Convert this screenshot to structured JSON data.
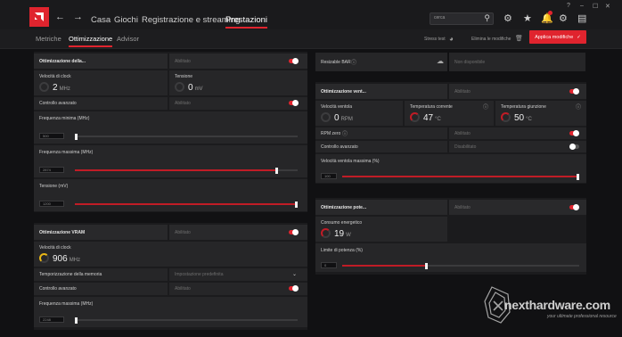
{
  "topbar": {
    "logo": "AMD",
    "tabs": [
      {
        "label": "Casa"
      },
      {
        "label": "Giochi"
      },
      {
        "label": "Registrazione e streaming"
      },
      {
        "label": "Prestazioni"
      }
    ],
    "search_placeholder": "cerca",
    "icons": [
      "back-icon",
      "forward-icon",
      "search-icon",
      "bug-icon",
      "star-icon",
      "bell-icon",
      "gear-icon",
      "sidebar-icon"
    ],
    "window_controls": [
      "?",
      "–",
      "☐",
      "✕"
    ]
  },
  "subbar": {
    "tabs": [
      {
        "label": "Metriche"
      },
      {
        "label": "Ottimizzazione"
      },
      {
        "label": "Advisor"
      }
    ],
    "stress_test": "Stress test",
    "discard": "Elimina le modifiche",
    "apply": "Applica modifiche"
  },
  "gpu_tuning": {
    "title": "Ottimizzazione della...",
    "status": "Abilitato",
    "clock_label": "Velocità di clock",
    "clock_value": "2",
    "clock_unit": "MHz",
    "voltage_label": "Tensione",
    "voltage_value": "0",
    "voltage_unit": "mV",
    "advanced_label": "Controllo avanzato",
    "advanced_status": "Abilitato",
    "min_freq_label": "Frequenza minima (MHz)",
    "min_freq_value": "500",
    "min_freq_fraction": 0.0,
    "max_freq_label": "Frequenza massima (MHz)",
    "max_freq_value": "2874",
    "max_freq_fraction": 0.91,
    "voltage_slider_label": "Tensione (mV)",
    "voltage_slider_value": "1200",
    "voltage_slider_fraction": 1.0
  },
  "vram_tuning": {
    "title": "Ottimizzazione VRAM",
    "status": "Abilitato",
    "clock_label": "Velocità di clock",
    "clock_value": "906",
    "clock_unit": "MHz",
    "timing_label": "Temporizzazione della memoria",
    "timing_value": "Impostazione predefinita",
    "advanced_label": "Controllo avanzato",
    "advanced_status": "Abilitato",
    "max_freq_label": "Frequenza massima (MHz)",
    "max_freq_value": "2248",
    "max_freq_fraction": 0.0
  },
  "resizable_bar": {
    "label": "Resizable BAR",
    "status": "Non disponibile"
  },
  "fan_tuning": {
    "title": "Ottimizzazione vent...",
    "status": "Abilitato",
    "fan_speed_label": "Velocità ventola",
    "fan_speed_value": "0",
    "fan_speed_unit": "RPM",
    "temp_current_label": "Temperatura corrente",
    "temp_current_value": "47",
    "temp_unit": "°C",
    "temp_junction_label": "Temperatura giunzione",
    "temp_junction_value": "50",
    "zero_rpm_label": "RPM zero",
    "zero_rpm_status": "Abilitato",
    "advanced_label": "Controllo avanzato",
    "advanced_status": "Disabilitato",
    "max_speed_label": "Velocità ventola massima (%)",
    "max_speed_value": "100",
    "max_speed_fraction": 1.0
  },
  "power_tuning": {
    "title": "Ottimizzazione pote...",
    "status": "Abilitato",
    "power_label": "Consumo energetico",
    "power_value": "19",
    "power_unit": "W",
    "limit_label": "Limite di potenza (%)",
    "limit_value": "0",
    "limit_fraction": 0.36
  },
  "watermark": {
    "brand": "nexthardware.com",
    "tagline": "your ultimate professional resource"
  },
  "colors": {
    "accent": "#e0242e",
    "background": "#111113",
    "panel": "#1b1b1d",
    "gauge_yellow": "#e8b617"
  }
}
